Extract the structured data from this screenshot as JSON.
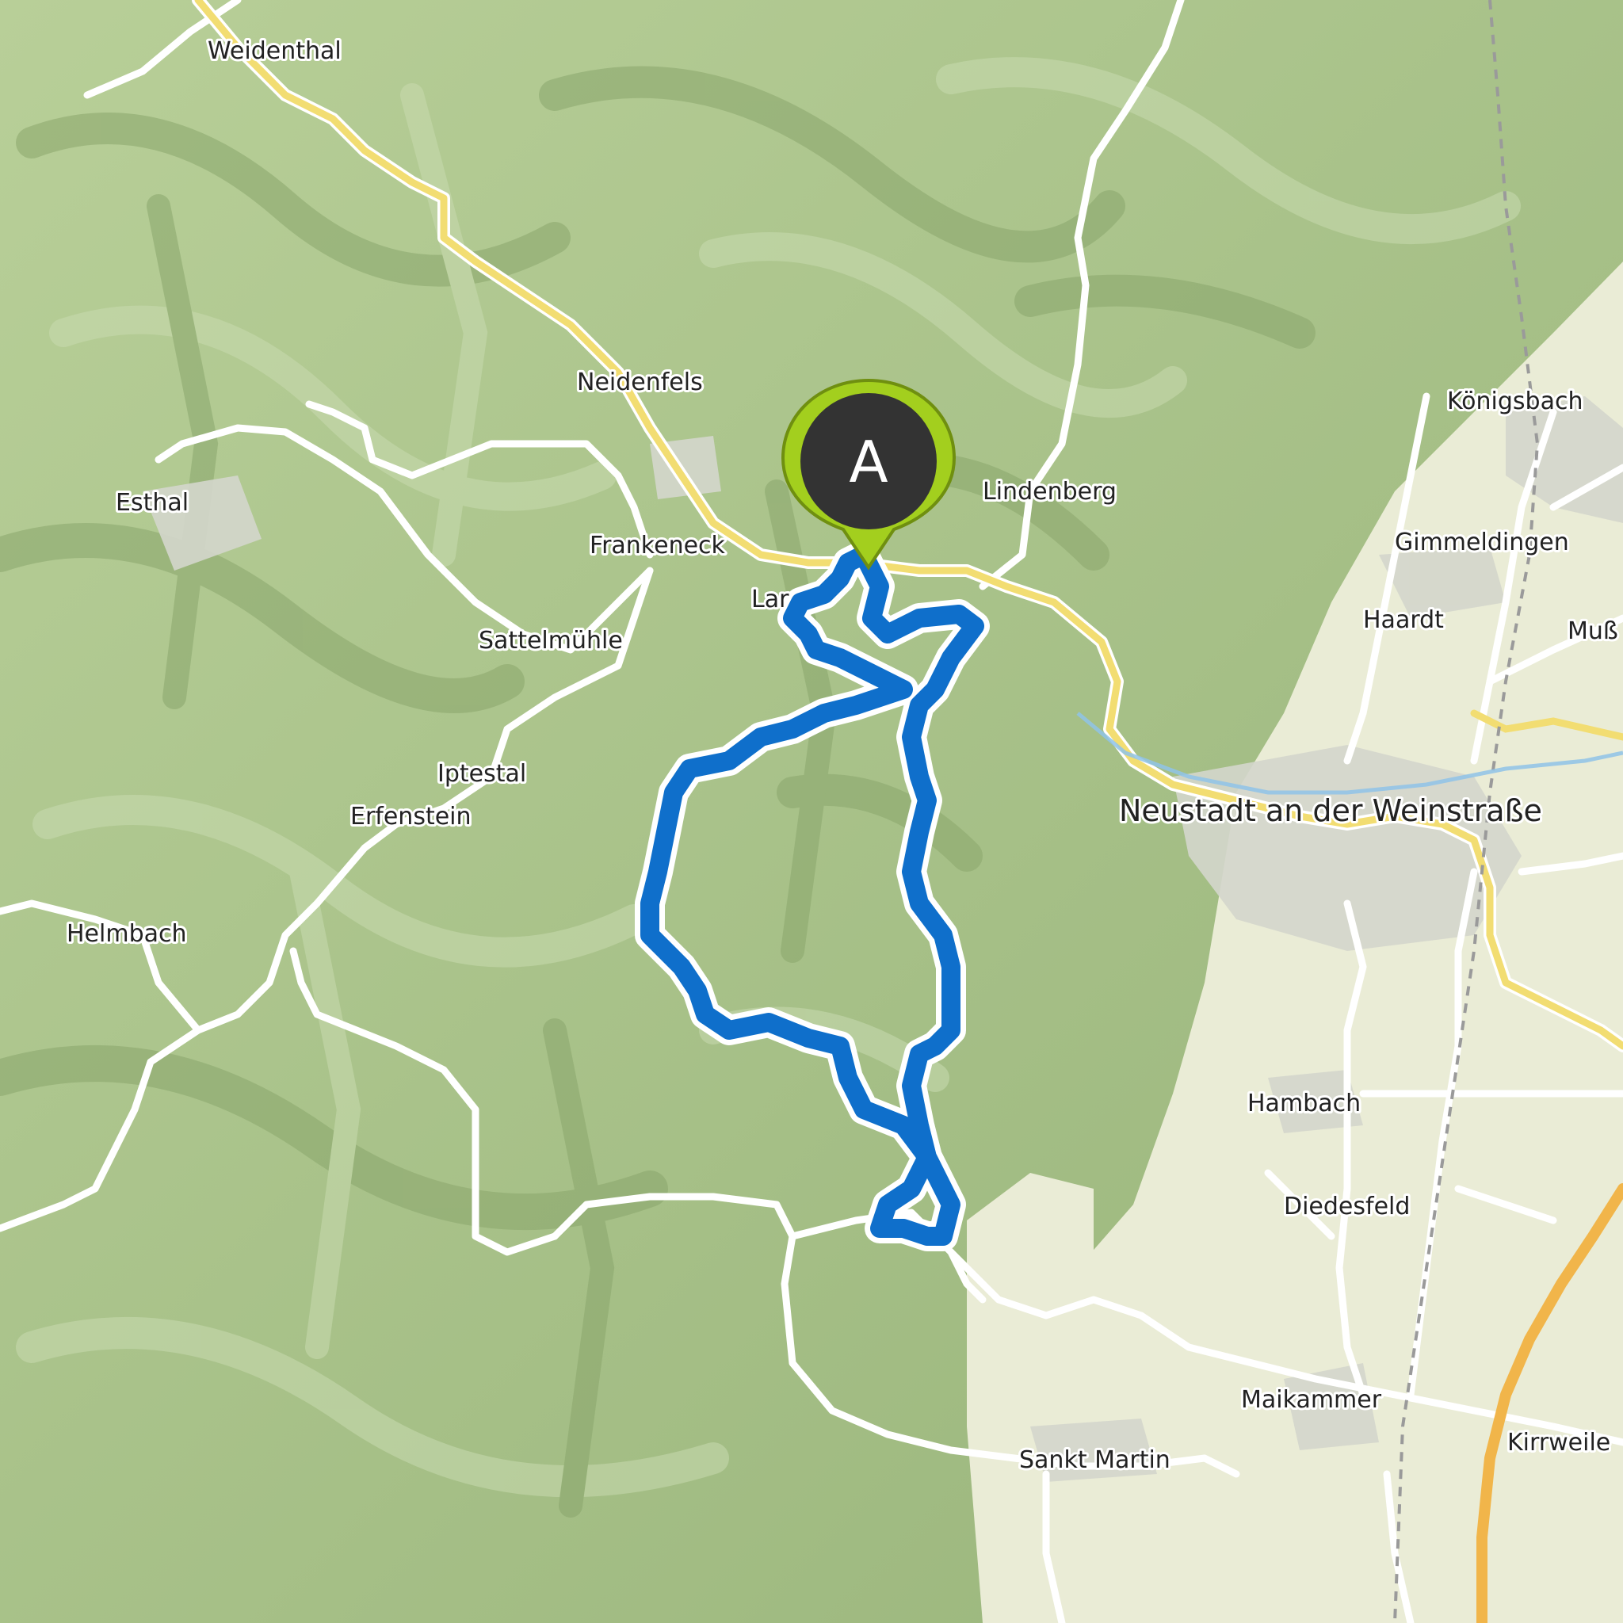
{
  "map": {
    "colors": {
      "forest": "#a9c48a",
      "lowland": "#eaecd6",
      "road_white": "#ffffff",
      "road_yellow": "#f2dd72",
      "road_orange": "#f1b54a",
      "route": "#0f6fcb",
      "marker_green": "#a3cf1e",
      "marker_dark": "#333333"
    },
    "marker": {
      "letter": "A",
      "icon": "map-pin-icon"
    },
    "places": {
      "weidenthal": "Weidenthal",
      "neidenfels": "Neidenfels",
      "esthal": "Esthal",
      "frankeneck": "Frankeneck",
      "lambrecht": "Lar",
      "lindenberg": "Lindenberg",
      "koenigsbach": "Königsbach",
      "gimmeldingen": "Gimmeldingen",
      "haardt": "Haardt",
      "mussbach": "Muß",
      "sattelmuehle": "Sattelmühle",
      "iptestal": "Iptestal",
      "erfenstein": "Erfenstein",
      "neustadt": "Neustadt an der Weinstraße",
      "helmbach": "Helmbach",
      "hambach": "Hambach",
      "diedesfeld": "Diedesfeld",
      "maikammer": "Maikammer",
      "kirrweiler": "Kirrweile",
      "sankt_martin": "Sankt Martin"
    }
  }
}
